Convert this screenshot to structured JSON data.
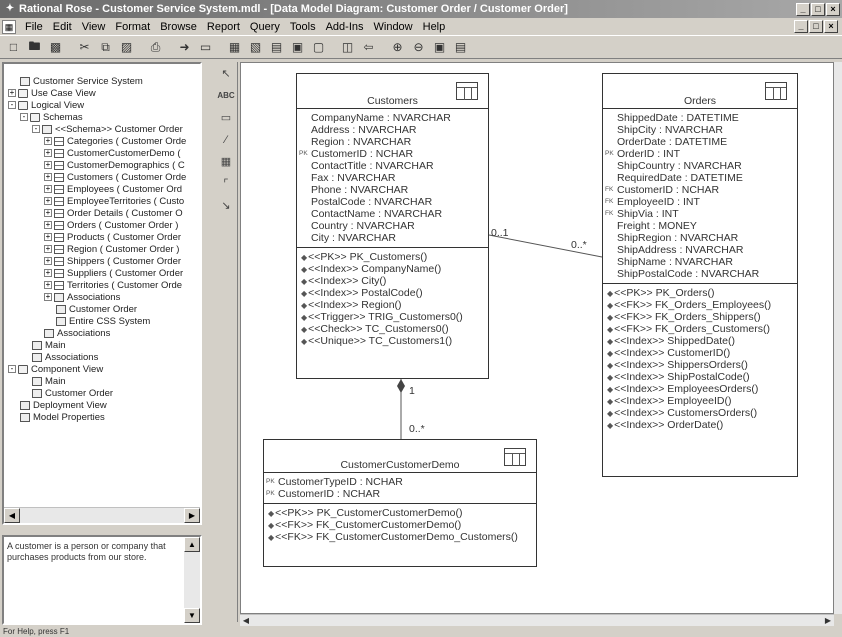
{
  "window": {
    "title": "Rational Rose - Customer Service System.mdl - [Data Model Diagram: Customer Order / Customer Order]"
  },
  "menu": [
    "File",
    "Edit",
    "View",
    "Format",
    "Browse",
    "Report",
    "Query",
    "Tools",
    "Add-Ins",
    "Window",
    "Help"
  ],
  "browser": {
    "tree": [
      {
        "label": "Customer Service System",
        "depth": 0,
        "exp": "",
        "icon": "model"
      },
      {
        "label": "Use Case View",
        "depth": 0,
        "exp": "+",
        "icon": "folder"
      },
      {
        "label": "Logical View",
        "depth": 0,
        "exp": "-",
        "icon": "folder"
      },
      {
        "label": "Schemas",
        "depth": 1,
        "exp": "-",
        "icon": "folder"
      },
      {
        "label": "<<Schema>> Customer Order",
        "depth": 2,
        "exp": "-",
        "icon": "schema"
      },
      {
        "label": "Categories ( Customer Orde",
        "depth": 3,
        "exp": "+",
        "icon": "table"
      },
      {
        "label": "CustomerCustomerDemo (",
        "depth": 3,
        "exp": "+",
        "icon": "table"
      },
      {
        "label": "CustomerDemographics ( C",
        "depth": 3,
        "exp": "+",
        "icon": "table"
      },
      {
        "label": "Customers ( Customer Orde",
        "depth": 3,
        "exp": "+",
        "icon": "table"
      },
      {
        "label": "Employees ( Customer Ord",
        "depth": 3,
        "exp": "+",
        "icon": "table"
      },
      {
        "label": "EmployeeTerritories ( Custo",
        "depth": 3,
        "exp": "+",
        "icon": "table"
      },
      {
        "label": "Order Details ( Customer O",
        "depth": 3,
        "exp": "+",
        "icon": "table"
      },
      {
        "label": "Orders ( Customer Order )",
        "depth": 3,
        "exp": "+",
        "icon": "table"
      },
      {
        "label": "Products ( Customer Order",
        "depth": 3,
        "exp": "+",
        "icon": "table"
      },
      {
        "label": "Region ( Customer Order )",
        "depth": 3,
        "exp": "+",
        "icon": "table"
      },
      {
        "label": "Shippers ( Customer Order",
        "depth": 3,
        "exp": "+",
        "icon": "table"
      },
      {
        "label": "Suppliers ( Customer Order",
        "depth": 3,
        "exp": "+",
        "icon": "table"
      },
      {
        "label": "Territories ( Customer Orde",
        "depth": 3,
        "exp": "+",
        "icon": "table"
      },
      {
        "label": "Associations",
        "depth": 3,
        "exp": "+",
        "icon": "assoc"
      },
      {
        "label": "Customer Order",
        "depth": 3,
        "exp": "",
        "icon": "diagram"
      },
      {
        "label": "Entire CSS System",
        "depth": 3,
        "exp": "",
        "icon": "diagram"
      },
      {
        "label": "Associations",
        "depth": 2,
        "exp": "",
        "icon": "assoc"
      },
      {
        "label": "Main",
        "depth": 1,
        "exp": "",
        "icon": "diagram"
      },
      {
        "label": "Associations",
        "depth": 1,
        "exp": "",
        "icon": "assoc"
      },
      {
        "label": "Component View",
        "depth": 0,
        "exp": "-",
        "icon": "folder"
      },
      {
        "label": "Main",
        "depth": 1,
        "exp": "",
        "icon": "diagram"
      },
      {
        "label": "Customer Order",
        "depth": 1,
        "exp": "",
        "icon": "component"
      },
      {
        "label": "Deployment View",
        "depth": 0,
        "exp": "",
        "icon": "deploy"
      },
      {
        "label": "Model Properties",
        "depth": 0,
        "exp": "",
        "icon": "props"
      }
    ]
  },
  "documentation": {
    "text": "A customer is a person or company that purchases products from our store."
  },
  "entities": {
    "customers": {
      "name": "Customers",
      "attributes": [
        {
          "key": "",
          "text": "CompanyName : NVARCHAR"
        },
        {
          "key": "",
          "text": "Address : NVARCHAR"
        },
        {
          "key": "",
          "text": "Region : NVARCHAR"
        },
        {
          "key": "PK",
          "text": "CustomerID : NCHAR"
        },
        {
          "key": "",
          "text": "ContactTitle : NVARCHAR"
        },
        {
          "key": "",
          "text": "Fax : NVARCHAR"
        },
        {
          "key": "",
          "text": "Phone : NVARCHAR"
        },
        {
          "key": "",
          "text": "PostalCode : NVARCHAR"
        },
        {
          "key": "",
          "text": "ContactName : NVARCHAR"
        },
        {
          "key": "",
          "text": "Country : NVARCHAR"
        },
        {
          "key": "",
          "text": "City : NVARCHAR"
        }
      ],
      "operations": [
        "<<PK>> PK_Customers()",
        "<<Index>> CompanyName()",
        "<<Index>> City()",
        "<<Index>> PostalCode()",
        "<<Index>> Region()",
        "<<Trigger>> TRIG_Customers0()",
        "<<Check>> TC_Customers0()",
        "<<Unique>> TC_Customers1()"
      ]
    },
    "orders": {
      "name": "Orders",
      "attributes": [
        {
          "key": "",
          "text": "ShippedDate : DATETIME"
        },
        {
          "key": "",
          "text": "ShipCity : NVARCHAR"
        },
        {
          "key": "",
          "text": "OrderDate : DATETIME"
        },
        {
          "key": "PK",
          "text": "OrderID : INT"
        },
        {
          "key": "",
          "text": "ShipCountry : NVARCHAR"
        },
        {
          "key": "",
          "text": "RequiredDate : DATETIME"
        },
        {
          "key": "FK",
          "text": "CustomerID : NCHAR"
        },
        {
          "key": "FK",
          "text": "EmployeeID : INT"
        },
        {
          "key": "FK",
          "text": "ShipVia : INT"
        },
        {
          "key": "",
          "text": "Freight : MONEY"
        },
        {
          "key": "",
          "text": "ShipRegion : NVARCHAR"
        },
        {
          "key": "",
          "text": "ShipAddress : NVARCHAR"
        },
        {
          "key": "",
          "text": "ShipName : NVARCHAR"
        },
        {
          "key": "",
          "text": "ShipPostalCode : NVARCHAR"
        }
      ],
      "operations": [
        "<<PK>> PK_Orders()",
        "<<FK>> FK_Orders_Employees()",
        "<<FK>> FK_Orders_Shippers()",
        "<<FK>> FK_Orders_Customers()",
        "<<Index>> ShippedDate()",
        "<<Index>> CustomerID()",
        "<<Index>> ShippersOrders()",
        "<<Index>> ShipPostalCode()",
        "<<Index>> EmployeesOrders()",
        "<<Index>> EmployeeID()",
        "<<Index>> CustomersOrders()",
        "<<Index>> OrderDate()"
      ]
    },
    "demo": {
      "name": "CustomerCustomerDemo",
      "attributes": [
        {
          "key": "PK",
          "text": "CustomerTypeID : NCHAR"
        },
        {
          "key": "PK",
          "text": "CustomerID : NCHAR"
        }
      ],
      "operations": [
        "<<PK>> PK_CustomerCustomerDemo()",
        "<<FK>> FK_CustomerCustomerDemo()",
        "<<FK>> FK_CustomerCustomerDemo_Customers()"
      ]
    }
  },
  "multiplicities": {
    "cust_orders_left": "0..1",
    "cust_orders_right": "0..*",
    "cust_demo_top": "1",
    "cust_demo_bottom": "0..*"
  },
  "status": {
    "text": "For Help, press F1"
  }
}
